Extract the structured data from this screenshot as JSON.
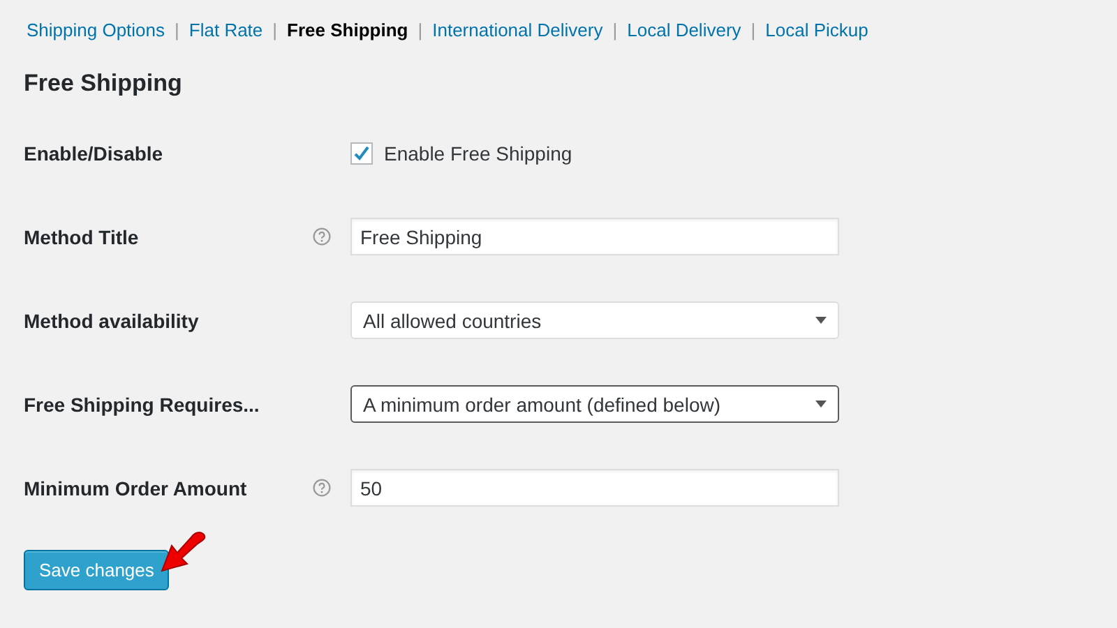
{
  "nav": [
    {
      "label": "Shipping Options",
      "selected": false
    },
    {
      "label": "Flat Rate",
      "selected": false
    },
    {
      "label": "Free Shipping",
      "selected": true
    },
    {
      "label": "International Delivery",
      "selected": false
    },
    {
      "label": "Local Delivery",
      "selected": false
    },
    {
      "label": "Local Pickup",
      "selected": false
    }
  ],
  "separator": "|",
  "heading": "Free Shipping",
  "fields": [
    {
      "kind": "checkbox",
      "label": "Enable/Disable",
      "help": false,
      "checked": true,
      "text": "Enable Free Shipping"
    },
    {
      "kind": "text",
      "label": "Method Title",
      "help": true,
      "value": "Free Shipping"
    },
    {
      "kind": "select",
      "label": "Method availability",
      "help": false,
      "value": "All allowed countries",
      "focused": false
    },
    {
      "kind": "select",
      "label": "Free Shipping Requires...",
      "help": false,
      "value": "A minimum order amount (defined below)",
      "focused": true
    },
    {
      "kind": "text",
      "label": "Minimum Order Amount",
      "help": true,
      "value": "50"
    }
  ],
  "save_button": "Save changes"
}
